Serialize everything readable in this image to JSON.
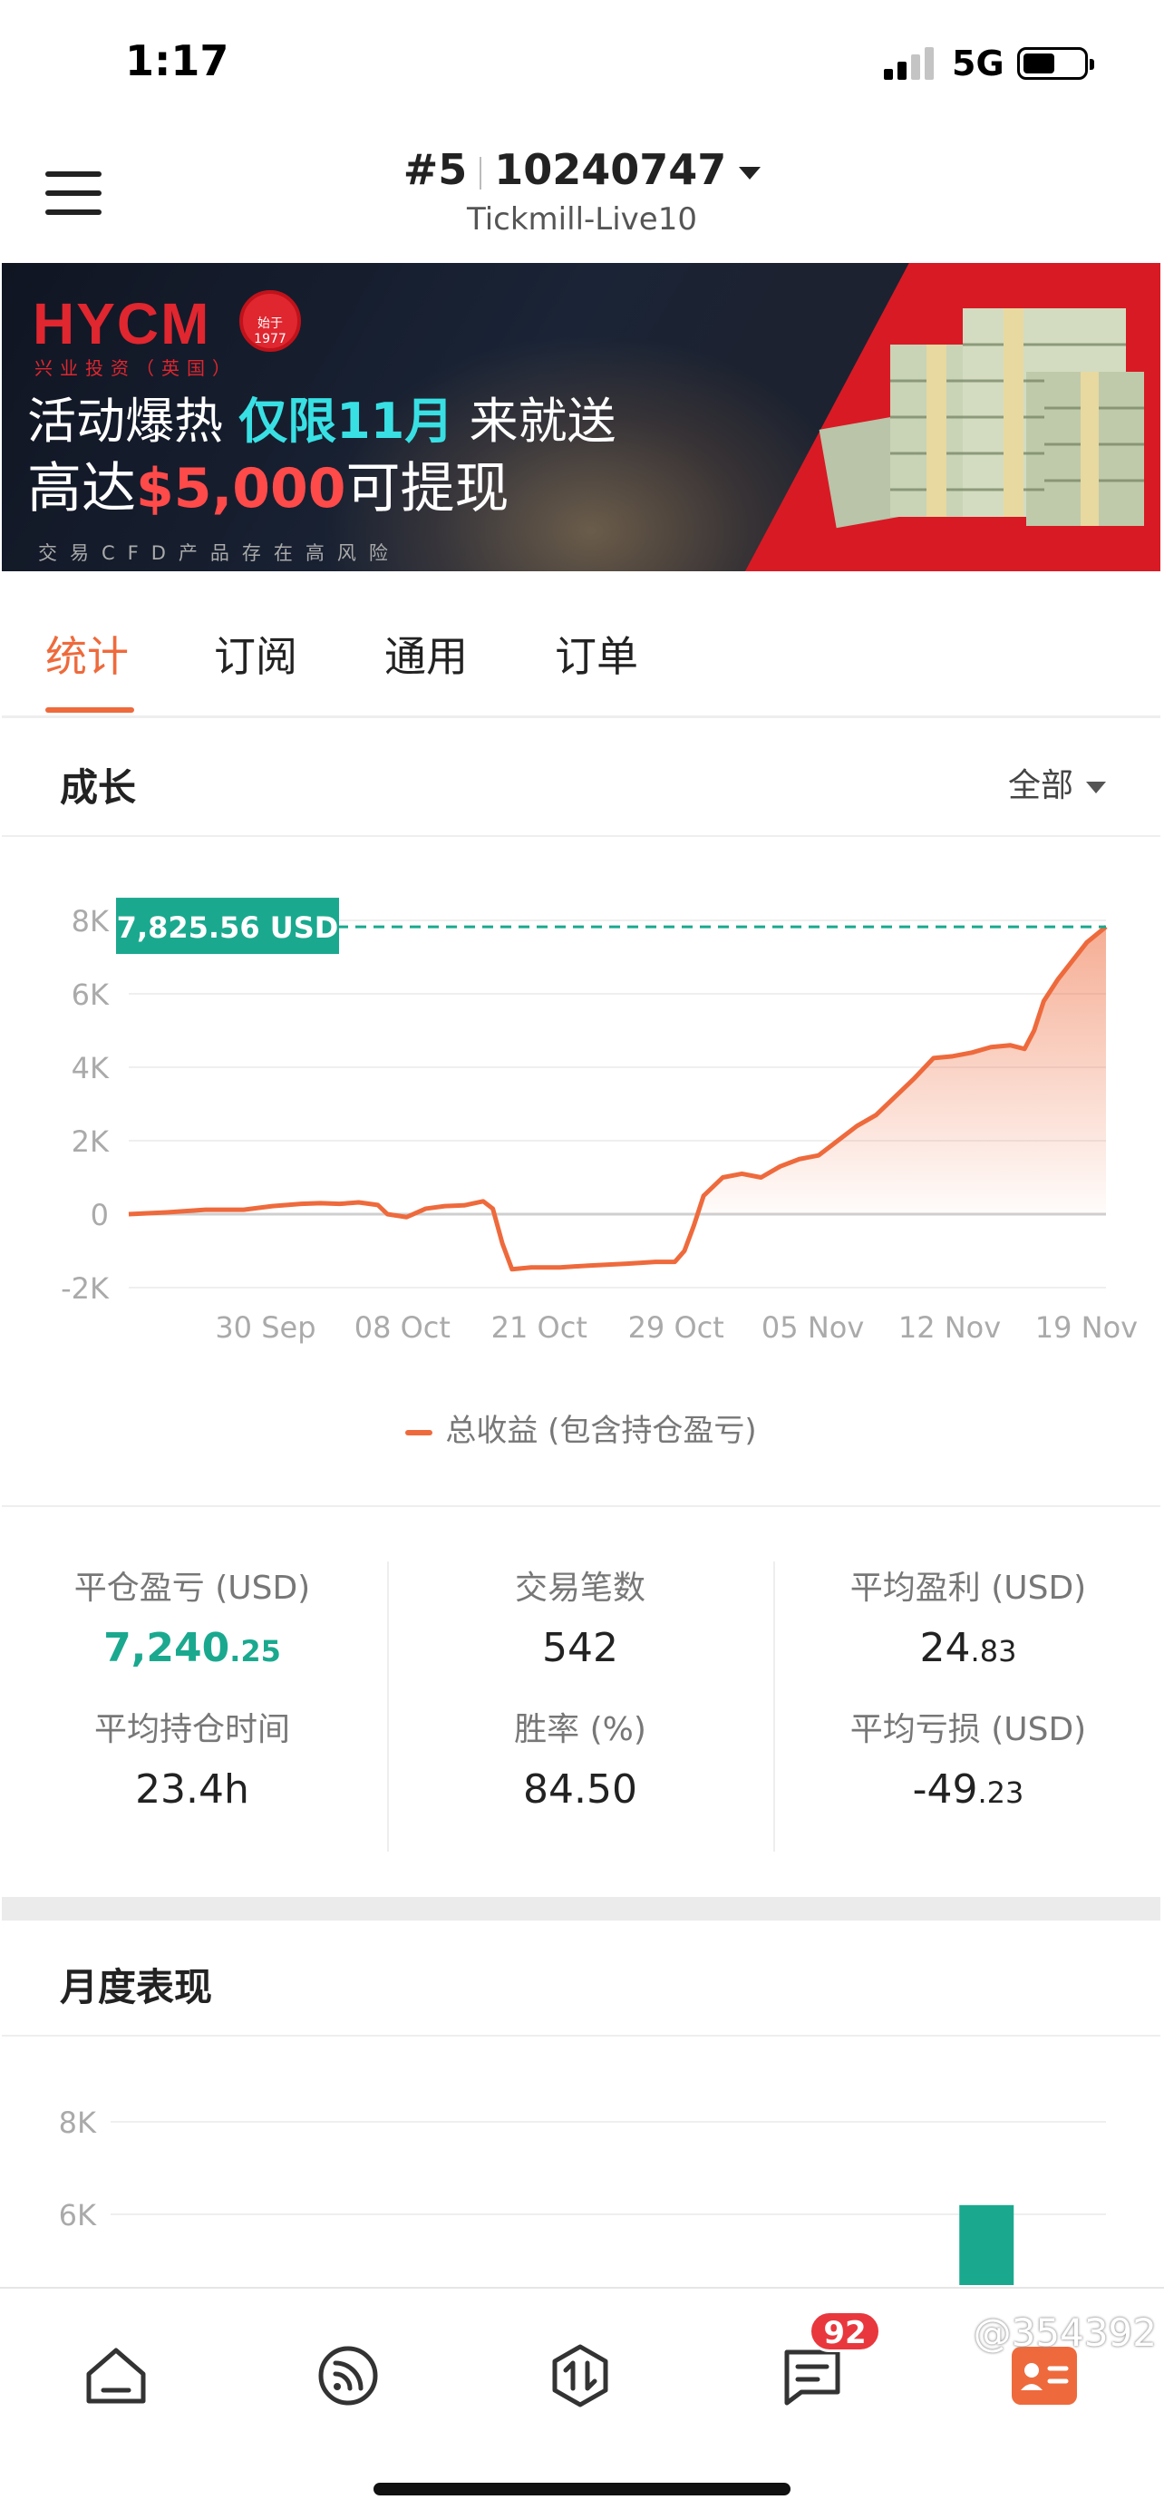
{
  "status_bar": {
    "time": "1:17",
    "network": "5G"
  },
  "header": {
    "account_number": "#5",
    "account_id": "10240747",
    "server": "Tickmill-Live10"
  },
  "banner": {
    "logo": "HYCM",
    "logo_sub": "兴业投资（英国）",
    "seal_text": "始于1977",
    "line1_a": "活动爆热 ",
    "line1_b": "仅限11月",
    "line1_c": " 来就送",
    "line2_a": "高达",
    "line2_b": "$5,000",
    "line2_c": "可提现",
    "risk": "交易CFD产品存在高风险",
    "colors": {
      "red": "#d81a25",
      "cyan": "#38e0e4"
    }
  },
  "tabs": [
    {
      "label": "统计",
      "active": true
    },
    {
      "label": "订阅",
      "active": false
    },
    {
      "label": "通用",
      "active": false
    },
    {
      "label": "订单",
      "active": false
    }
  ],
  "growth": {
    "title": "成长",
    "range": "全部",
    "legend": "总收益 (包含持仓盈亏)"
  },
  "chart_data": [
    {
      "type": "area",
      "current_label": "7,825.56 USD",
      "current_value": 7825.56,
      "y_ticks": [
        "8K",
        "6K",
        "4K",
        "2K",
        "0",
        "-2K"
      ],
      "y_tick_values": [
        8000,
        6000,
        4000,
        2000,
        0,
        -2000
      ],
      "ylim": [
        -2000,
        8000
      ],
      "x_ticks": [
        "30 Sep",
        "08 Oct",
        "21 Oct",
        "29 Oct",
        "05 Nov",
        "12 Nov",
        "19 Nov"
      ],
      "x_tick_pos": [
        0.14,
        0.28,
        0.42,
        0.56,
        0.7,
        0.84,
        0.98
      ],
      "series": [
        {
          "name": "总收益 (包含持仓盈亏)",
          "color": "#ee6a3c",
          "points": [
            [
              0,
              0
            ],
            [
              0.04,
              50
            ],
            [
              0.08,
              120
            ],
            [
              0.12,
              120
            ],
            [
              0.15,
              220
            ],
            [
              0.18,
              280
            ],
            [
              0.2,
              300
            ],
            [
              0.22,
              280
            ],
            [
              0.24,
              320
            ],
            [
              0.26,
              250
            ],
            [
              0.27,
              0
            ],
            [
              0.29,
              -80
            ],
            [
              0.31,
              150
            ],
            [
              0.33,
              220
            ],
            [
              0.35,
              240
            ],
            [
              0.37,
              350
            ],
            [
              0.38,
              150
            ],
            [
              0.39,
              -800
            ],
            [
              0.4,
              -1500
            ],
            [
              0.42,
              -1450
            ],
            [
              0.45,
              -1450
            ],
            [
              0.48,
              -1400
            ],
            [
              0.52,
              -1350
            ],
            [
              0.55,
              -1300
            ],
            [
              0.57,
              -1300
            ],
            [
              0.58,
              -1000
            ],
            [
              0.59,
              -300
            ],
            [
              0.6,
              500
            ],
            [
              0.62,
              1000
            ],
            [
              0.64,
              1100
            ],
            [
              0.66,
              1000
            ],
            [
              0.68,
              1300
            ],
            [
              0.7,
              1500
            ],
            [
              0.72,
              1600
            ],
            [
              0.74,
              2000
            ],
            [
              0.76,
              2400
            ],
            [
              0.78,
              2700
            ],
            [
              0.8,
              3200
            ],
            [
              0.82,
              3700
            ],
            [
              0.84,
              4250
            ],
            [
              0.86,
              4300
            ],
            [
              0.88,
              4400
            ],
            [
              0.9,
              4550
            ],
            [
              0.92,
              4600
            ],
            [
              0.935,
              4500
            ],
            [
              0.945,
              5000
            ],
            [
              0.955,
              5800
            ],
            [
              0.97,
              6400
            ],
            [
              0.985,
              6900
            ],
            [
              1.0,
              7400
            ],
            [
              1.02,
              7825.56
            ]
          ]
        }
      ]
    },
    {
      "type": "bar",
      "y_ticks": [
        "8K",
        "6K"
      ],
      "y_tick_values": [
        8000,
        6000
      ],
      "ylim": [
        0,
        8500
      ],
      "series": [
        {
          "color": "#1aa98f",
          "values": [
            {
              "x": 0.88,
              "y": 6200
            }
          ]
        }
      ]
    }
  ],
  "stats": {
    "closed_pl_label": "平仓盈亏 (USD)",
    "closed_pl_int": "7,240",
    "closed_pl_dec": ".25",
    "trades_label": "交易笔数",
    "trades": "542",
    "avg_profit_label": "平均盈利 (USD)",
    "avg_profit_int": "24",
    "avg_profit_dec": ".83",
    "avg_hold_label": "平均持仓时间",
    "avg_hold": "23.4h",
    "win_rate_label": "胜率 (%)",
    "win_rate": "84.50",
    "avg_loss_label": "平均亏损 (USD)",
    "avg_loss_int": "-49",
    "avg_loss_dec": ".23"
  },
  "monthly": {
    "title": "月度表现"
  },
  "bottom_nav": {
    "items": [
      "home-icon",
      "feed-icon",
      "trade-icon",
      "messages-icon",
      "profile-card-icon"
    ],
    "badge": "92",
    "watermark": "@354392"
  }
}
